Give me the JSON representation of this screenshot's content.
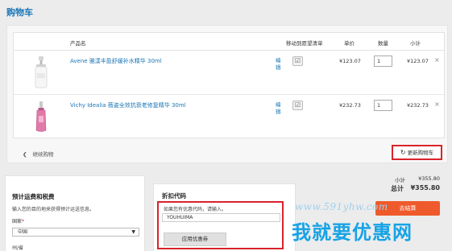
{
  "page": {
    "title": "购物车"
  },
  "cart": {
    "columns": {
      "product": "产品名",
      "wishlist": "移动到愿望清单",
      "unit_price": "单价",
      "quantity": "数量",
      "subtotal": "小计"
    },
    "items": [
      {
        "name": "Avene 雅漾丰盈舒缓补水精华 30ml",
        "edit": "编辑",
        "unit_price": "¥123.07",
        "quantity": "1",
        "subtotal": "¥123.07",
        "remove": "×"
      },
      {
        "name": "Vichy Idealia 薇姿全效抗衰老修复精华 30ml",
        "edit": "编辑",
        "unit_price": "¥232.73",
        "quantity": "1",
        "subtotal": "¥232.73",
        "remove": "×"
      }
    ],
    "continue_shopping": "继续购物",
    "update_cart": "更新购物车"
  },
  "totals": {
    "subtotal_label": "小计",
    "subtotal_value": "¥355.80",
    "grand_label": "总计",
    "grand_value": "¥355.80"
  },
  "shipping": {
    "title": "预计运费和税费",
    "description": "输入您的目的地来获得预计运送信息。",
    "country_label": "国家",
    "country_required": "*",
    "country_value": "中国",
    "province_label": "州/省"
  },
  "coupon": {
    "title": "折扣代码",
    "description": "如果您有优惠代码，请输入。",
    "code_value": "YOUHUIMA",
    "apply_label": "应用优惠券"
  },
  "checkout": {
    "label": "去结算"
  },
  "watermark": {
    "url": "www.591yhw.com",
    "text": "我就要优惠网"
  },
  "colors": {
    "accent": "#1a76b6",
    "highlight": "#d9232b",
    "checkout": "#ef5a2c"
  }
}
